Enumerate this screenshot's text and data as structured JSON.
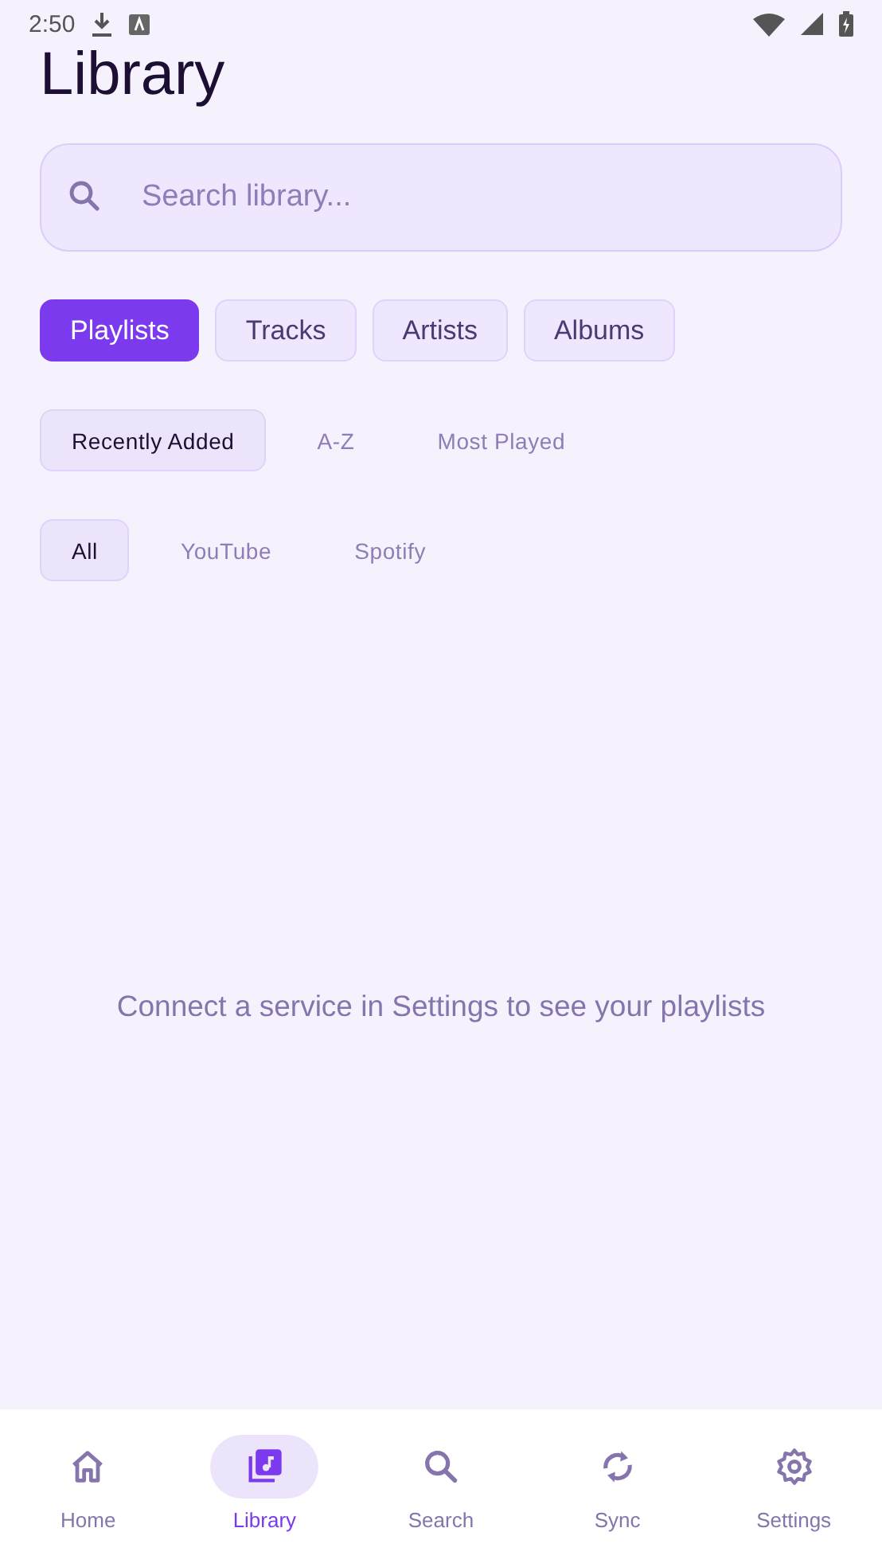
{
  "status_bar": {
    "time": "2:50"
  },
  "title": "Library",
  "search": {
    "placeholder": "Search library..."
  },
  "tabs": [
    {
      "label": "Playlists",
      "selected": true
    },
    {
      "label": "Tracks",
      "selected": false
    },
    {
      "label": "Artists",
      "selected": false
    },
    {
      "label": "Albums",
      "selected": false
    }
  ],
  "sort_options": [
    {
      "label": "Recently Added",
      "selected": true
    },
    {
      "label": "A-Z",
      "selected": false
    },
    {
      "label": "Most Played",
      "selected": false
    }
  ],
  "source_filters": [
    {
      "label": "All",
      "selected": true
    },
    {
      "label": "YouTube",
      "selected": false
    },
    {
      "label": "Spotify",
      "selected": false
    }
  ],
  "empty_message": "Connect a service in Settings to see your playlists",
  "bottom_nav": [
    {
      "label": "Home",
      "selected": false
    },
    {
      "label": "Library",
      "selected": true
    },
    {
      "label": "Search",
      "selected": false
    },
    {
      "label": "Sync",
      "selected": false
    },
    {
      "label": "Settings",
      "selected": false
    }
  ]
}
